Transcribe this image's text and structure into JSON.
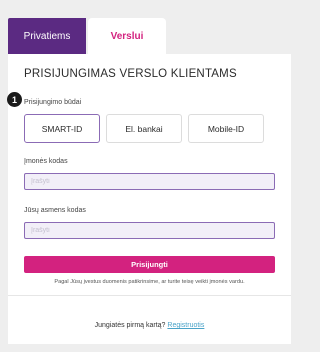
{
  "tabs": [
    {
      "label": "Privatiems",
      "active": false
    },
    {
      "label": "Verslui",
      "active": true
    }
  ],
  "form": {
    "title": "PRISIJUNGIMAS VERSLO KLIENTAMS",
    "step_badge": "1",
    "methods_label": "Prisijungimo būdai",
    "methods": [
      {
        "label": "SMART-ID",
        "selected": true
      },
      {
        "label": "El. bankai",
        "selected": false
      },
      {
        "label": "Mobile-ID",
        "selected": false
      }
    ],
    "company_code_label": "Įmonės kodas",
    "company_code_placeholder": "Įrašyti",
    "personal_code_label": "Jūsų asmens kodas",
    "personal_code_placeholder": "Įrašyti",
    "submit_label": "Prisijungti",
    "notice": "Pagal Jūsų įvestus duomenis patikrinsime, ar turite teisę veikti įmonės vardu."
  },
  "footer": {
    "prompt": "Jungiatės pirmą kartą?",
    "register_link": "Registruotis"
  },
  "colors": {
    "brand_purple": "#5b2a82",
    "brand_pink": "#d3227f",
    "input_border": "#8b6bb5",
    "link": "#4aa3c8"
  }
}
